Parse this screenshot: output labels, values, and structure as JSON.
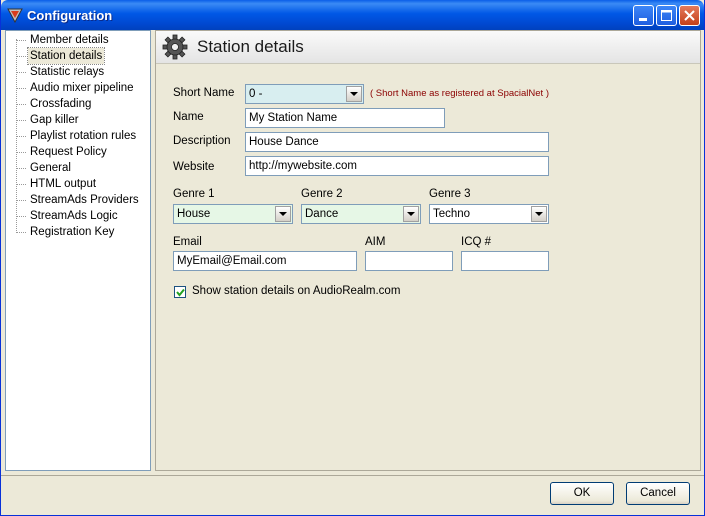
{
  "window": {
    "title": "Configuration",
    "titlebar_color": "#0058e6"
  },
  "tree": {
    "items": [
      {
        "label": "Member details"
      },
      {
        "label": "Station details",
        "selected": true
      },
      {
        "label": "Statistic relays"
      },
      {
        "label": "Audio mixer pipeline"
      },
      {
        "label": "Crossfading"
      },
      {
        "label": "Gap killer"
      },
      {
        "label": "Playlist rotation rules"
      },
      {
        "label": "Request Policy"
      },
      {
        "label": "General"
      },
      {
        "label": "HTML output"
      },
      {
        "label": "StreamAds Providers"
      },
      {
        "label": "StreamAds Logic"
      },
      {
        "label": "Registration Key"
      }
    ]
  },
  "panel": {
    "title": "Station details",
    "short_name_label": "Short Name",
    "short_name_value": "0 -",
    "short_name_hint": "( Short Name as registered at SpacialNet )",
    "name_label": "Name",
    "name_value": "My Station Name",
    "description_label": "Description",
    "description_value": "House Dance",
    "website_label": "Website",
    "website_value": "http://mywebsite.com",
    "genre1_label": "Genre 1",
    "genre1_value": "House",
    "genre2_label": "Genre 2",
    "genre2_value": "Dance",
    "genre3_label": "Genre 3",
    "genre3_value": "Techno",
    "email_label": "Email",
    "email_value": "MyEmail@Email.com",
    "aim_label": "AIM",
    "aim_value": "",
    "icq_label": "ICQ #",
    "icq_value": "",
    "show_details_label": "Show station details on AudioRealm.com",
    "show_details_checked": true
  },
  "buttons": {
    "ok": "OK",
    "cancel": "Cancel"
  },
  "colors": {
    "short_name_bg": "#d8eef0",
    "genre_bg": "#e6f7e6",
    "hint": "#8b0000"
  },
  "icons": {
    "app": "sam-logo-icon",
    "header": "gear-icon",
    "minimize": "minimize-icon",
    "maximize": "maximize-icon",
    "close": "close-icon"
  }
}
